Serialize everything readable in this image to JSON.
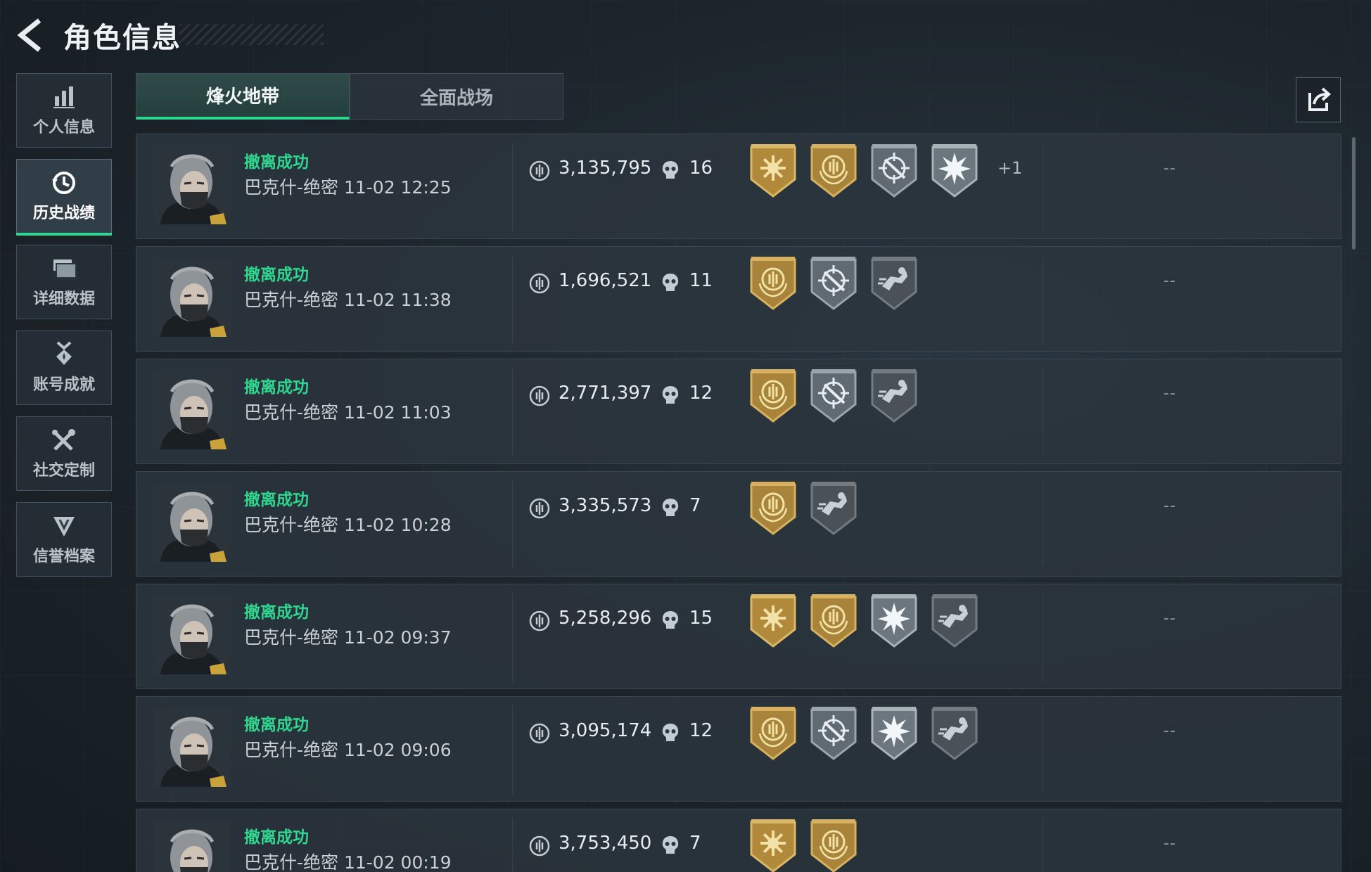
{
  "header": {
    "title": "角色信息"
  },
  "sidebar": {
    "items": [
      {
        "label": "个人信息",
        "icon": "bar-chart-icon",
        "active": false
      },
      {
        "label": "历史战绩",
        "icon": "history-clock-icon",
        "active": true
      },
      {
        "label": "详细数据",
        "icon": "folder-stack-icon",
        "active": false
      },
      {
        "label": "账号成就",
        "icon": "medal-icon",
        "active": false
      },
      {
        "label": "社交定制",
        "icon": "tools-icon",
        "active": false
      },
      {
        "label": "信誉档案",
        "icon": "credit-shield-icon",
        "active": false
      }
    ]
  },
  "tabs": [
    {
      "label": "烽火地带",
      "active": true
    },
    {
      "label": "全面战场",
      "active": false
    }
  ],
  "accent_color": "#2fd68f",
  "matches": [
    {
      "status": "撤离成功",
      "map": "巴克什-绝密 11-02 12:25",
      "money": "3,135,795",
      "kills": "16",
      "badges": [
        "sunburst-gold",
        "emblem-gold",
        "crosshair-silver",
        "burst-silver"
      ],
      "extra": "+1",
      "rank": "--"
    },
    {
      "status": "撤离成功",
      "map": "巴克什-绝密 11-02 11:38",
      "money": "1,696,521",
      "kills": "11",
      "badges": [
        "emblem-gold",
        "crosshair-silver",
        "runner-dark"
      ],
      "extra": "",
      "rank": "--"
    },
    {
      "status": "撤离成功",
      "map": "巴克什-绝密 11-02 11:03",
      "money": "2,771,397",
      "kills": "12",
      "badges": [
        "emblem-gold",
        "crosshair-silver",
        "runner-dark"
      ],
      "extra": "",
      "rank": "--"
    },
    {
      "status": "撤离成功",
      "map": "巴克什-绝密 11-02 10:28",
      "money": "3,335,573",
      "kills": "7",
      "badges": [
        "emblem-gold",
        "runner-dark"
      ],
      "extra": "",
      "rank": "--"
    },
    {
      "status": "撤离成功",
      "map": "巴克什-绝密 11-02 09:37",
      "money": "5,258,296",
      "kills": "15",
      "badges": [
        "sunburst-gold",
        "emblem-gold",
        "burst-silver",
        "runner-dark"
      ],
      "extra": "",
      "rank": "--"
    },
    {
      "status": "撤离成功",
      "map": "巴克什-绝密 11-02 09:06",
      "money": "3,095,174",
      "kills": "12",
      "badges": [
        "emblem-gold",
        "crosshair-silver",
        "burst-silver",
        "runner-dark"
      ],
      "extra": "",
      "rank": "--"
    },
    {
      "status": "撤离成功",
      "map": "巴克什-绝密 11-02 00:19",
      "money": "3,753,450",
      "kills": "7",
      "badges": [
        "sunburst-gold",
        "emblem-gold"
      ],
      "extra": "",
      "rank": "--"
    }
  ]
}
